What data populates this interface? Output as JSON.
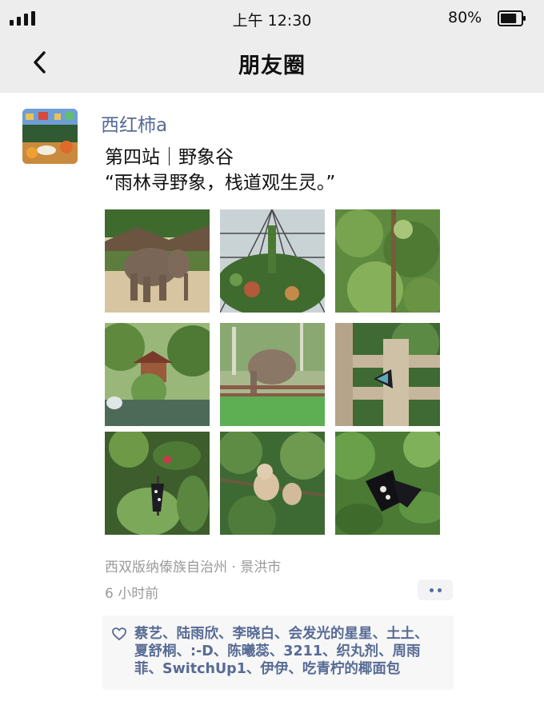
{
  "status_bar": {
    "time": "上午 12:30",
    "battery_percent": "80%",
    "battery_level": 0.8
  },
  "nav": {
    "title": "朋友圈"
  },
  "post": {
    "username": "西红柿a",
    "text_lines": [
      "第四站｜野象谷",
      "“雨林寻野象，栈道观生灵。”"
    ],
    "location": "西双版纳傣族自治州 · 景洪市",
    "time_ago": "6 小时前",
    "photos": [
      {
        "name": "elephant-photo"
      },
      {
        "name": "greenhouse-photo"
      },
      {
        "name": "forest-foliage-photo"
      },
      {
        "name": "jungle-pavilion-photo"
      },
      {
        "name": "elephant-fence-photo"
      },
      {
        "name": "butterfly-on-railing-photo"
      },
      {
        "name": "butterfly-on-leaf-photo"
      },
      {
        "name": "gibbon-photo"
      },
      {
        "name": "black-butterfly-photo"
      }
    ],
    "likes_lines": [
      "蔡艺、陆雨欣、李晓白、会发光的星星、土土、",
      "夏舒桐、:-D、陈曦蕊、3211、织丸剂、周雨",
      "菲、SwitchUp1、伊伊、吃青柠的椰面包"
    ]
  },
  "colors": {
    "link": "#576b95",
    "meta": "#9a9a9a",
    "header_bg": "#ededed"
  },
  "icons": [
    "signal-icon",
    "battery-icon",
    "back-arrow-icon",
    "more-dots-icon",
    "heart-icon"
  ]
}
